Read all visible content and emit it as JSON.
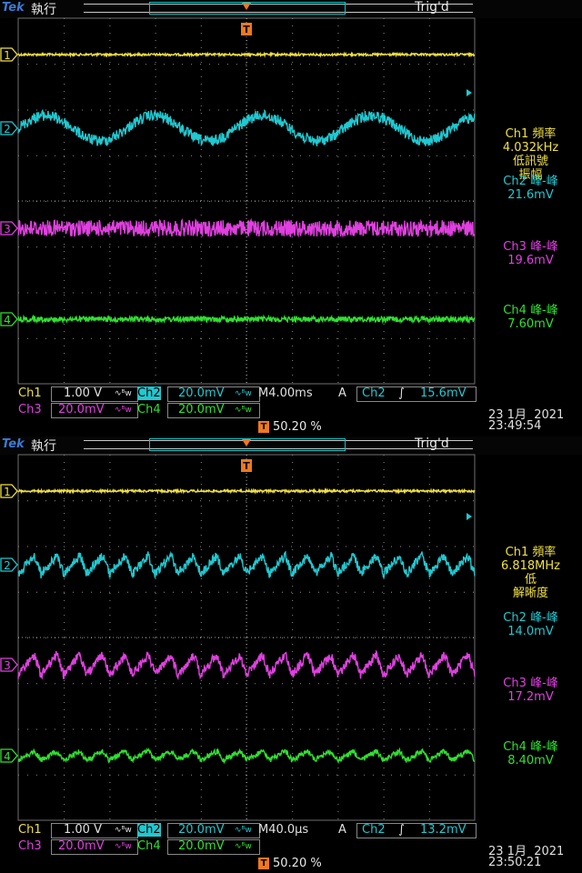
{
  "colors": {
    "ch1": "#f0e040",
    "ch2": "#20c8d0",
    "ch3": "#e040e0",
    "ch4": "#30e030",
    "trigger": "#f07820",
    "grid": "#707070",
    "text": "#cfcfcf"
  },
  "screens": [
    {
      "brand": "Tek",
      "run_state": "執行",
      "trigger_state": "Trig'd",
      "channel_markers": [
        "1",
        "2",
        "3",
        "4"
      ],
      "readouts": [
        {
          "label": "Ch1 頻率",
          "value": "4.032kHz",
          "note_lines": [
            "低訊號",
            "振幅"
          ],
          "channel": "ch1"
        },
        {
          "label": "Ch2 峰-峰",
          "value": "21.6mV",
          "note_lines": [],
          "channel": "ch2"
        },
        {
          "label": "Ch3 峰-峰",
          "value": "19.6mV",
          "note_lines": [],
          "channel": "ch3"
        },
        {
          "label": "Ch4 峰-峰",
          "value": "7.60mV",
          "note_lines": [],
          "channel": "ch4"
        }
      ],
      "settings": {
        "ch1_label": "Ch1",
        "ch1_scale": "1.00 V",
        "ch2_label": "Ch2",
        "ch2_scale": "20.0mV",
        "ch3_label": "Ch3",
        "ch3_scale": "20.0mV",
        "ch4_label": "Ch4",
        "ch4_scale": "20.0mV",
        "coupling_symbol": "∿ᴮw",
        "timebase": "M 4.00ms",
        "trigger_mode": "A",
        "trigger_source": "Ch2",
        "trigger_slope": "∫",
        "trigger_level": "15.6mV",
        "trigger_position": "50.20 %",
        "date": "23 1月  2021",
        "time": "23:49:54"
      },
      "waveforms": {
        "ch2_cycles": 4.2,
        "ch2_shape": "sine",
        "ch3_shape": "noise",
        "ch4_shape": "noise"
      }
    },
    {
      "brand": "Tek",
      "run_state": "執行",
      "trigger_state": "Trig'd",
      "channel_markers": [
        "1",
        "2",
        "3",
        "4"
      ],
      "readouts": [
        {
          "label": "Ch1 頻率",
          "value": "6.818MHz",
          "note_lines": [
            "低",
            "解晰度"
          ],
          "channel": "ch1"
        },
        {
          "label": "Ch2 峰-峰",
          "value": "14.0mV",
          "note_lines": [],
          "channel": "ch2"
        },
        {
          "label": "Ch3 峰-峰",
          "value": "17.2mV",
          "note_lines": [],
          "channel": "ch3"
        },
        {
          "label": "Ch4 峰-峰",
          "value": "8.40mV",
          "note_lines": [],
          "channel": "ch4"
        }
      ],
      "settings": {
        "ch1_label": "Ch1",
        "ch1_scale": "1.00 V",
        "ch2_label": "Ch2",
        "ch2_scale": "20.0mV",
        "ch3_label": "Ch3",
        "ch3_scale": "20.0mV",
        "ch4_label": "Ch4",
        "ch4_scale": "20.0mV",
        "coupling_symbol": "∿ᴮw",
        "timebase": "M 40.0µs",
        "trigger_mode": "A",
        "trigger_source": "Ch2",
        "trigger_slope": "∫",
        "trigger_level": "13.2mV",
        "trigger_position": "50.20 %",
        "date": "23 1月  2021",
        "time": "23:50:21"
      },
      "waveforms": {
        "ch2_cycles": 20,
        "ch2_shape": "sawtooth",
        "ch3_shape": "sawtooth",
        "ch4_shape": "sawtooth"
      }
    }
  ]
}
